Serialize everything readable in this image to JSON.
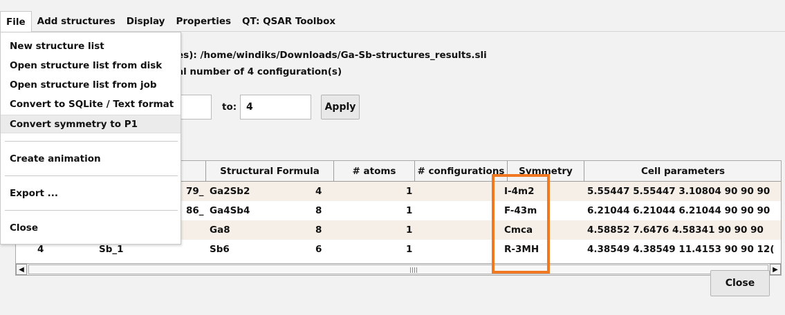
{
  "menubar": {
    "items": [
      "File",
      "Add structures",
      "Display",
      "Properties",
      "QT: QSAR Toolbox"
    ]
  },
  "info": {
    "path_line": "es): /home/windiks/Downloads/Ga-Sb-structures_results.sli",
    "count_line": "al number of 4 configuration(s)"
  },
  "range": {
    "from_value": "",
    "to_label": "to:",
    "to_value": "4",
    "apply_label": "Apply"
  },
  "table": {
    "headers": [
      "Structural Formula",
      "# atoms",
      "# configurations",
      "Symmetry",
      "Cell parameters"
    ],
    "rows": [
      {
        "index": "",
        "name": "79_",
        "formula": "Ga2Sb2",
        "atoms": "4",
        "configs": "1",
        "symmetry": "I-4m2",
        "cell": "5.55447 5.55447 3.10804 90 90 90"
      },
      {
        "index": "",
        "name": "86_",
        "formula": "Ga4Sb4",
        "atoms": "8",
        "configs": "1",
        "symmetry": "F-43m",
        "cell": "6.21044 6.21044 6.21044 90 90 90"
      },
      {
        "index": "",
        "name": "",
        "formula": "Ga8",
        "atoms": "8",
        "configs": "1",
        "symmetry": "Cmca",
        "cell": "4.58852 7.6476 4.58341 90 90 90"
      },
      {
        "index": "4",
        "name": "Sb_1",
        "formula": "Sb6",
        "atoms": "6",
        "configs": "1",
        "symmetry": "R-3MH",
        "cell": "4.38549 4.38549 11.4153 90 90 12("
      }
    ]
  },
  "file_menu": {
    "items": [
      "New structure list",
      "Open structure list from disk",
      "Open structure list from job",
      "Convert to SQLite / Text format",
      "Convert symmetry to P1",
      "Create animation",
      "Export ...",
      "Close"
    ],
    "hovered_item": "Convert symmetry to P1"
  },
  "footer": {
    "close_label": "Close"
  },
  "colors": {
    "highlight": "#f07820",
    "alt_row": "#f5efe8"
  }
}
